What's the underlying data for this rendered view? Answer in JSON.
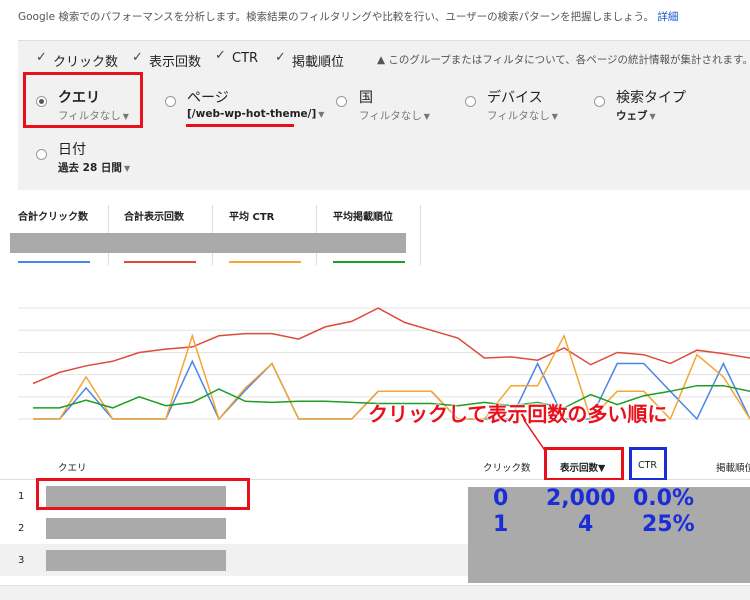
{
  "description": {
    "text": "Google 検索でのパフォーマンスを分析します。検索結果のフィルタリングや比較を行い、ユーザーの検索パターンを把握しましょう。",
    "link": "詳細"
  },
  "metrics": [
    {
      "label": "クリック数",
      "checked": true
    },
    {
      "label": "表示回数",
      "checked": true
    },
    {
      "label": "CTR",
      "checked": true
    },
    {
      "label": "掲載順位",
      "checked": true
    }
  ],
  "notice": "このグループまたはフィルタについて、各ページの統計情報が集計されます。",
  "notice_icon": "warning-icon",
  "dimensions": [
    {
      "title": "クエリ",
      "filter": "フィルタなし",
      "selected": true
    },
    {
      "title": "ページ",
      "filter": "[/web-wp-hot-theme/]",
      "selected": false
    },
    {
      "title": "国",
      "filter": "フィルタなし",
      "selected": false
    },
    {
      "title": "デバイス",
      "filter": "フィルタなし",
      "selected": false
    },
    {
      "title": "検索タイプ",
      "filter": "ウェブ",
      "selected": false
    },
    {
      "title": "日付",
      "filter": "過去 28 日間",
      "selected": false
    }
  ],
  "summary_headers": [
    "合計クリック数",
    "合計表示回数",
    "平均 CTR",
    "平均掲載順位"
  ],
  "colors": {
    "clicks": "#4a86e8",
    "impressions": "#dd4b39",
    "ctr": "#f4a532",
    "position": "#1b9e22",
    "highlight_red": "#e8101a",
    "highlight_blue": "#1a2ed8"
  },
  "chart_data": {
    "type": "line",
    "title": "",
    "xlabel": "",
    "ylabel": "",
    "x": [
      1,
      2,
      3,
      4,
      5,
      6,
      7,
      8,
      9,
      10,
      11,
      12,
      13,
      14,
      15,
      16,
      17,
      18,
      19,
      20,
      21,
      22,
      23,
      24,
      25,
      26,
      27,
      28
    ],
    "ylim": [
      0,
      110
    ],
    "grid": true,
    "series": [
      {
        "key": "impressions",
        "values": [
          32,
          42,
          48,
          52,
          60,
          63,
          65,
          75,
          77,
          77,
          72,
          83,
          88,
          100,
          87,
          80,
          73,
          55,
          56,
          53,
          64,
          49,
          60,
          58,
          50,
          62,
          59,
          55
        ]
      },
      {
        "key": "clicks",
        "values": [
          0,
          0,
          28,
          0,
          0,
          0,
          52,
          0,
          26,
          50,
          0,
          0,
          0,
          25,
          25,
          25,
          0,
          0,
          0,
          50,
          0,
          0,
          50,
          50,
          25,
          0,
          50,
          0
        ]
      },
      {
        "key": "ctr",
        "values": [
          0,
          0,
          38,
          0,
          0,
          0,
          75,
          0,
          28,
          50,
          0,
          0,
          0,
          25,
          25,
          25,
          0,
          0,
          30,
          30,
          75,
          0,
          25,
          25,
          0,
          58,
          38,
          0
        ]
      },
      {
        "key": "position",
        "values": [
          10,
          10,
          17,
          10,
          20,
          12,
          15,
          27,
          16,
          15,
          16,
          16,
          15,
          14,
          14,
          14,
          12,
          15,
          12,
          15,
          10,
          22,
          13,
          21,
          25,
          30,
          30,
          25
        ]
      }
    ]
  },
  "callout": "クリックして表示回数の多い順に",
  "table": {
    "headers": [
      "クエリ",
      "クリック数",
      "表示回数▼",
      "CTR",
      "掲載順位"
    ],
    "rows": [
      "1",
      "2",
      "3"
    ]
  },
  "stats": {
    "line1": {
      "clicks": "0",
      "impressions": "2,000",
      "ctr": "0.0%"
    },
    "line2": {
      "clicks": "1",
      "impressions": "4",
      "ctr": "25%"
    }
  }
}
